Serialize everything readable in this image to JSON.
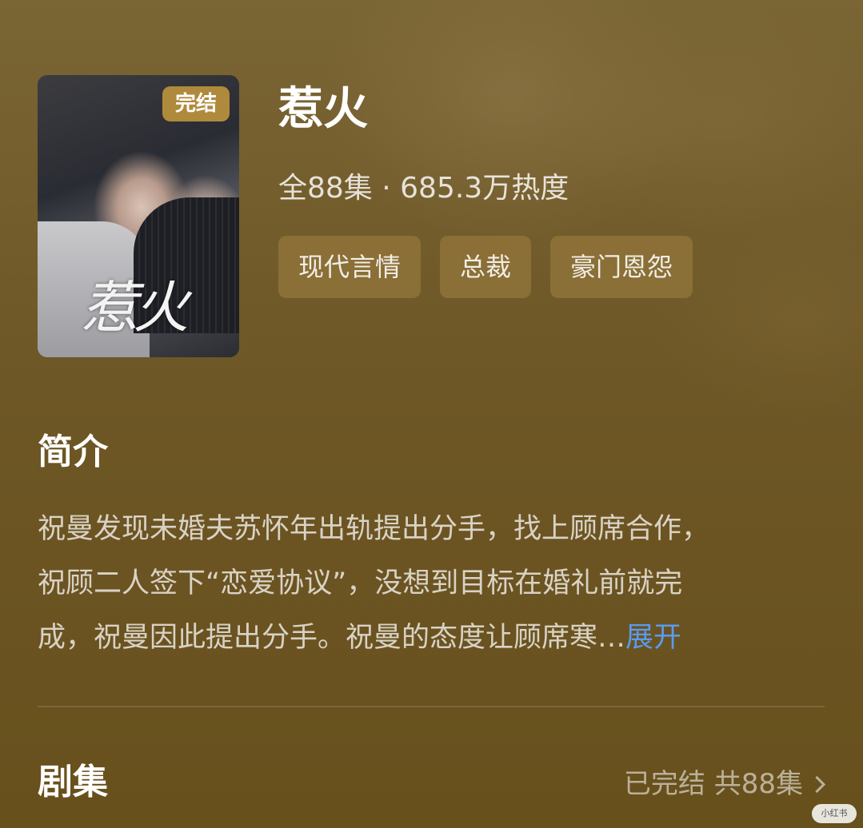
{
  "drama": {
    "title": "惹火",
    "status_badge": "完结",
    "poster_title": "惹火",
    "meta": "全88集 · 685.3万热度",
    "tags": [
      "现代言情",
      "总裁",
      "豪门恩怨"
    ]
  },
  "intro": {
    "heading": "简介",
    "lines": [
      "祝曼发现未婚夫苏怀年出轨提出分手，找上顾席合作，",
      "祝顾二人签下“恋爱协议”，没想到目标在婚礼前就完",
      "成，祝曼因此提出分手。祝曼的态度让顾席寒…"
    ],
    "expand_label": "展开"
  },
  "episodes": {
    "heading": "剧集",
    "status": "已完结 共88集"
  },
  "watermark": "小红书",
  "colors": {
    "background": "#6b5420",
    "badge": "#b08a3c",
    "link": "#5a9bf0"
  }
}
